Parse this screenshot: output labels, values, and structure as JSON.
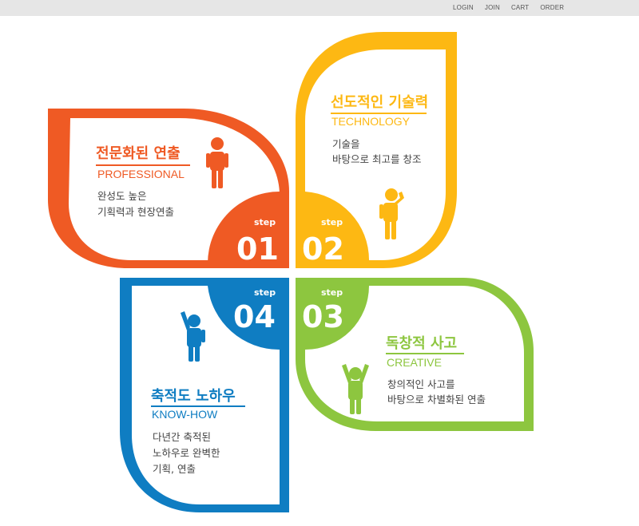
{
  "nav": {
    "items": [
      "LOGIN",
      "JOIN",
      "CART",
      "ORDER"
    ]
  },
  "colors": {
    "orange": "#ef5a24",
    "yellow": "#fdb813",
    "green": "#8dc63f",
    "blue": "#0f7dc2"
  },
  "steps": [
    {
      "step_word": "step",
      "number": "01",
      "title": "전문화된 연출",
      "subtitle": "PROFESSIONAL",
      "desc": [
        "완성도 높은",
        "기획력과 현장연출"
      ],
      "icon": "person-standing-icon"
    },
    {
      "step_word": "step",
      "number": "02",
      "title": "선도적인 기술력",
      "subtitle": "TECHNOLOGY",
      "desc": [
        "기술을",
        "바탕으로  최고를 창조"
      ],
      "icon": "person-thinking-icon"
    },
    {
      "step_word": "step",
      "number": "03",
      "title": "독창적 사고",
      "subtitle": "CREATIVE",
      "desc": [
        "창의적인 사고를",
        "바탕으로 차별화된 연출"
      ],
      "icon": "person-arms-up-icon"
    },
    {
      "step_word": "step",
      "number": "04",
      "title": "축적도 노하우",
      "subtitle": "KNOW-HOW",
      "desc": [
        "다년간 축적된",
        "노하우로 완벽한",
        "기획, 연출"
      ],
      "icon": "person-waving-icon"
    }
  ]
}
